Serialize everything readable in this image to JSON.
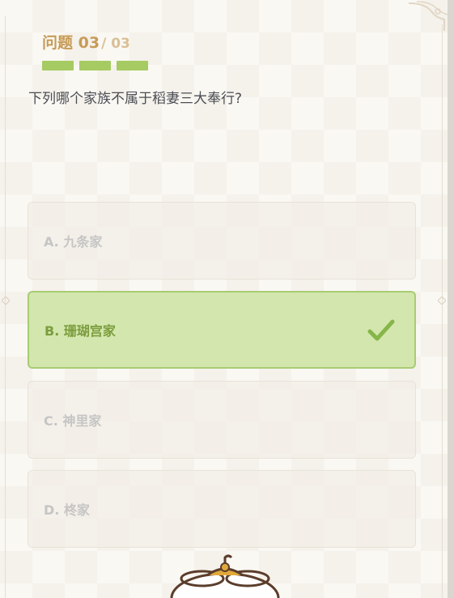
{
  "quiz": {
    "question_label": "问题 03",
    "question_total": "/ 03",
    "progress_segments": 3,
    "progress_color": "#a5cb62",
    "question_text": "下列哪个家族不属于稻妻三大奉行?",
    "options": [
      {
        "label": "A. 九条家",
        "selected": false
      },
      {
        "label": "B. 珊瑚宫家",
        "selected": true
      },
      {
        "label": "C. 神里家",
        "selected": false
      },
      {
        "label": "D. 柊家",
        "selected": false
      }
    ],
    "selected_icon": "checkmark-icon",
    "selected_color": "#d2e6ad",
    "accent_color": "#c79b56"
  }
}
